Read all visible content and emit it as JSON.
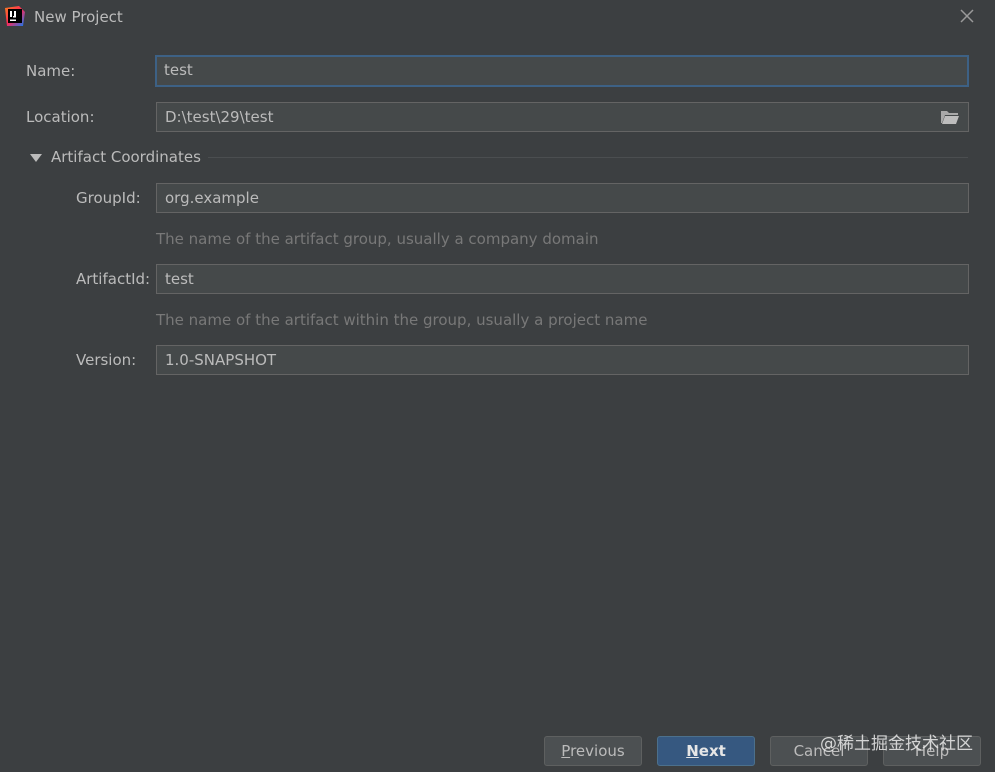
{
  "window": {
    "title": "New Project"
  },
  "form": {
    "name_label": "Name:",
    "name_value": "test",
    "location_label": "Location:",
    "location_value": "D:\\test\\29\\test"
  },
  "artifact_section": {
    "title": "Artifact Coordinates",
    "group_label": "GroupId:",
    "group_value": "org.example",
    "group_hint": "The name of the artifact group, usually a company domain",
    "artifact_label": "ArtifactId:",
    "artifact_value": "test",
    "artifact_hint": "The name of the artifact within the group, usually a project name",
    "version_label": "Version:",
    "version_value": "1.0-SNAPSHOT"
  },
  "buttons": {
    "previous_mnemonic": "P",
    "previous_rest": "revious",
    "next_mnemonic": "N",
    "next_rest": "ext",
    "cancel": "Cancel",
    "help": "Help"
  },
  "watermark": "@稀土掘金技术社区",
  "icons": {
    "app": "intellij-idea-logo",
    "close": "close-icon",
    "folder": "folder-open-icon",
    "expand": "triangle-down-icon"
  },
  "colors": {
    "background": "#3c3f41",
    "field_bg": "#45494a",
    "focus_border": "#3d6185",
    "primary_button": "#365880"
  }
}
